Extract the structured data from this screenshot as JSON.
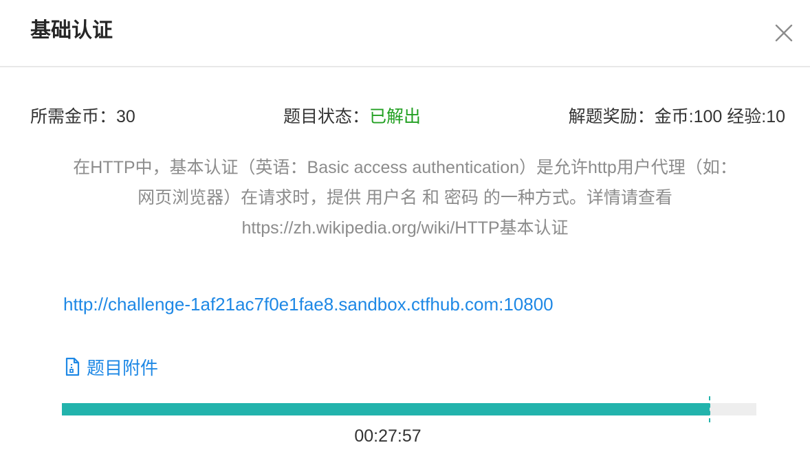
{
  "modal": {
    "title": "基础认证",
    "close_icon": "close-icon"
  },
  "info": {
    "cost_label": "所需金币：",
    "cost_value": "30",
    "status_label": "题目状态：",
    "status_value": "已解出",
    "status_color": "#22a022",
    "reward_text": "解题奖励：金币:100 经验:10"
  },
  "description": {
    "line1": "在HTTP中，基本认证（英语：Basic access authentication）是允许http用户代理（如：",
    "line2": "网页浏览器）在请求时，提供 用户名 和 密码 的一种方式。详情请查看",
    "line3": "https://zh.wikipedia.org/wiki/HTTP基本认证"
  },
  "challenge": {
    "url": "http://challenge-1af21ac7f0e1fae8.sandbox.ctfhub.com:10800"
  },
  "attachment": {
    "icon": "file-icon",
    "label": "题目附件"
  },
  "progress": {
    "fraction": 0.933,
    "time_text": "00:27:57",
    "fill_color": "#22b3ac"
  }
}
